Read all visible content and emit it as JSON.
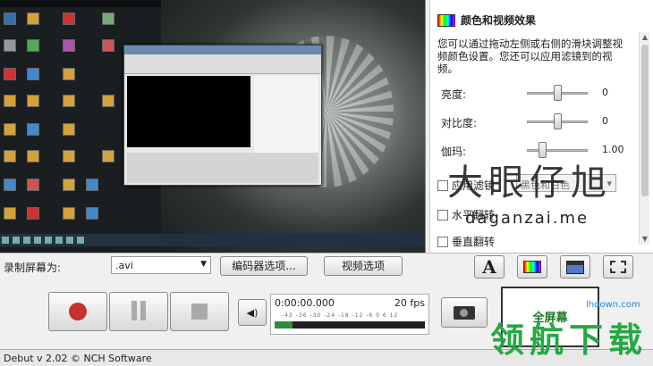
{
  "effects": {
    "title": "颜色和视频效果",
    "description": "您可以通过拖动左侧或右侧的滑块调整视频颜色设置。您还可以应用滤镜到的视频。",
    "brightness": {
      "label": "亮度:",
      "value": "0",
      "level": 0.5
    },
    "contrast": {
      "label": "对比度:",
      "value": "0",
      "level": 0.5
    },
    "gamma": {
      "label": "伽玛:",
      "value": "1.00",
      "level": 0.25
    },
    "apply_filter": {
      "label": "应用滤镜",
      "selected": "黑色和白色"
    },
    "flip_horizontal": "水平翻转",
    "flip_vertical": "垂直翻转"
  },
  "record_bar": {
    "label": "录制屏幕为:",
    "format": ".avi",
    "encoder_button": "编码器选项...",
    "video_button": "视频选项"
  },
  "controls": {
    "time": "0:00:00.000",
    "fps": "20 fps",
    "ticks": "-42  -36  -30  -24  -18  -12  -6  0  6  12",
    "level": 0.12,
    "fullscreen_label": "全屏幕"
  },
  "status_bar": {
    "text": "Debut v 2.02 © NCH Software"
  },
  "watermarks": {
    "w1": "大眼仔旭",
    "w2": "daganzai.me",
    "w3": "领航下载",
    "w4": "lhdown.com"
  },
  "icons": [
    "record-icon",
    "pause-icon",
    "stop-icon",
    "speaker-icon",
    "camera-icon",
    "text-overlay-icon",
    "color-effects-icon",
    "clapper-icon",
    "selection-icon"
  ]
}
